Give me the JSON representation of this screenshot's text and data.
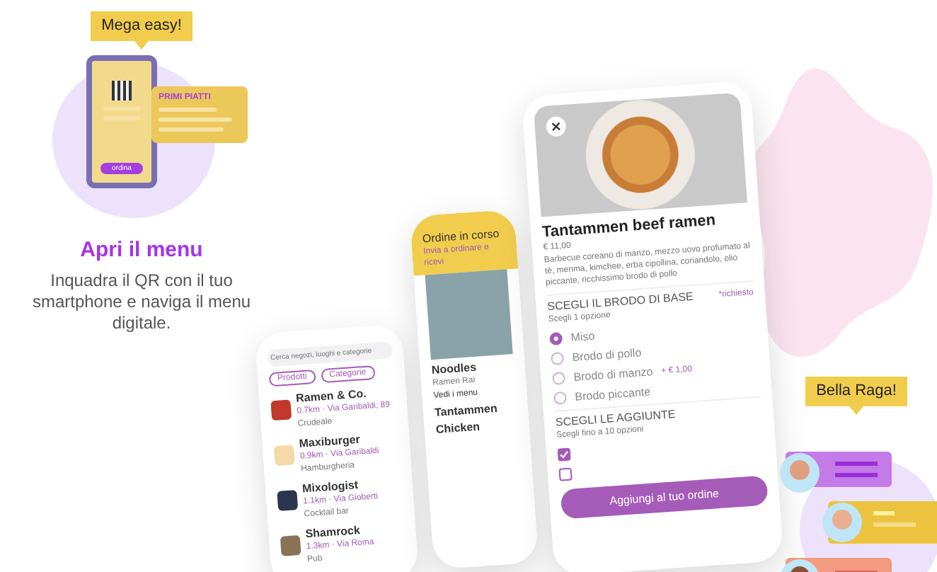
{
  "feature": {
    "bubble": "Mega easy!",
    "card_title": "PRIMI PIATTI",
    "phone_button": "ordina",
    "title": "Apri il menu",
    "description": "Inquadra il QR con il tuo smartphone e naviga il menu digitale."
  },
  "back_phone": {
    "search": {
      "placeholder": "Cerca negozi, luoghi e categorie"
    },
    "chips": [
      "Prodotti",
      "Categorie"
    ],
    "restaurants": [
      {
        "name": "Ramen & Co.",
        "meta": "0.7km · Via Garibaldi, 89",
        "tag": "Crudeale"
      },
      {
        "name": "Maxiburger",
        "meta": "0.9km · Via Garibaldi",
        "tag": "Hamburgheria"
      },
      {
        "name": "Mixologist",
        "meta": "1.1km · Via Gioberti",
        "tag": "Cocktail bar"
      },
      {
        "name": "Shamrock",
        "meta": "1.3km · Via Roma",
        "tag": "Pub"
      }
    ]
  },
  "middle_phone": {
    "banner": "Ordine in corso",
    "banner_sub": "Invia a ordinare e ricevi",
    "name": "Noodles",
    "subtitle": "Ramen Rai",
    "link": "Vedi i menu",
    "items": [
      {
        "name": "Tantammen"
      },
      {
        "name": "Chicken"
      }
    ]
  },
  "front_phone": {
    "dish": "Tantammen beef ramen",
    "price": "€ 11,00",
    "description": "Barbecue coreano di manzo, mezzo uovo profumato al tè, menma, kimchee, erba cipollina, coriandolo, olio piccante, ricchissimo brodo di pollo",
    "groups": [
      {
        "title": "SCEGLI IL BRODO DI BASE",
        "hint": "Scegli 1 opzione",
        "required": "*richiesto",
        "options": [
          {
            "label": "Miso",
            "selected": true
          },
          {
            "label": "Brodo di pollo",
            "selected": false
          },
          {
            "label": "Brodo di manzo",
            "selected": false,
            "extra": "+ € 1,00"
          },
          {
            "label": "Brodo piccante",
            "selected": false
          }
        ]
      },
      {
        "title": "SCEGLI LE AGGIUNTE",
        "hint": "Scegli fino a 10 opzioni",
        "options": [
          {
            "checked": true
          },
          {
            "checked": false
          }
        ]
      }
    ],
    "add_button": "Aggiungi al tuo ordine"
  },
  "community": {
    "bubble": "Bella Raga!"
  }
}
